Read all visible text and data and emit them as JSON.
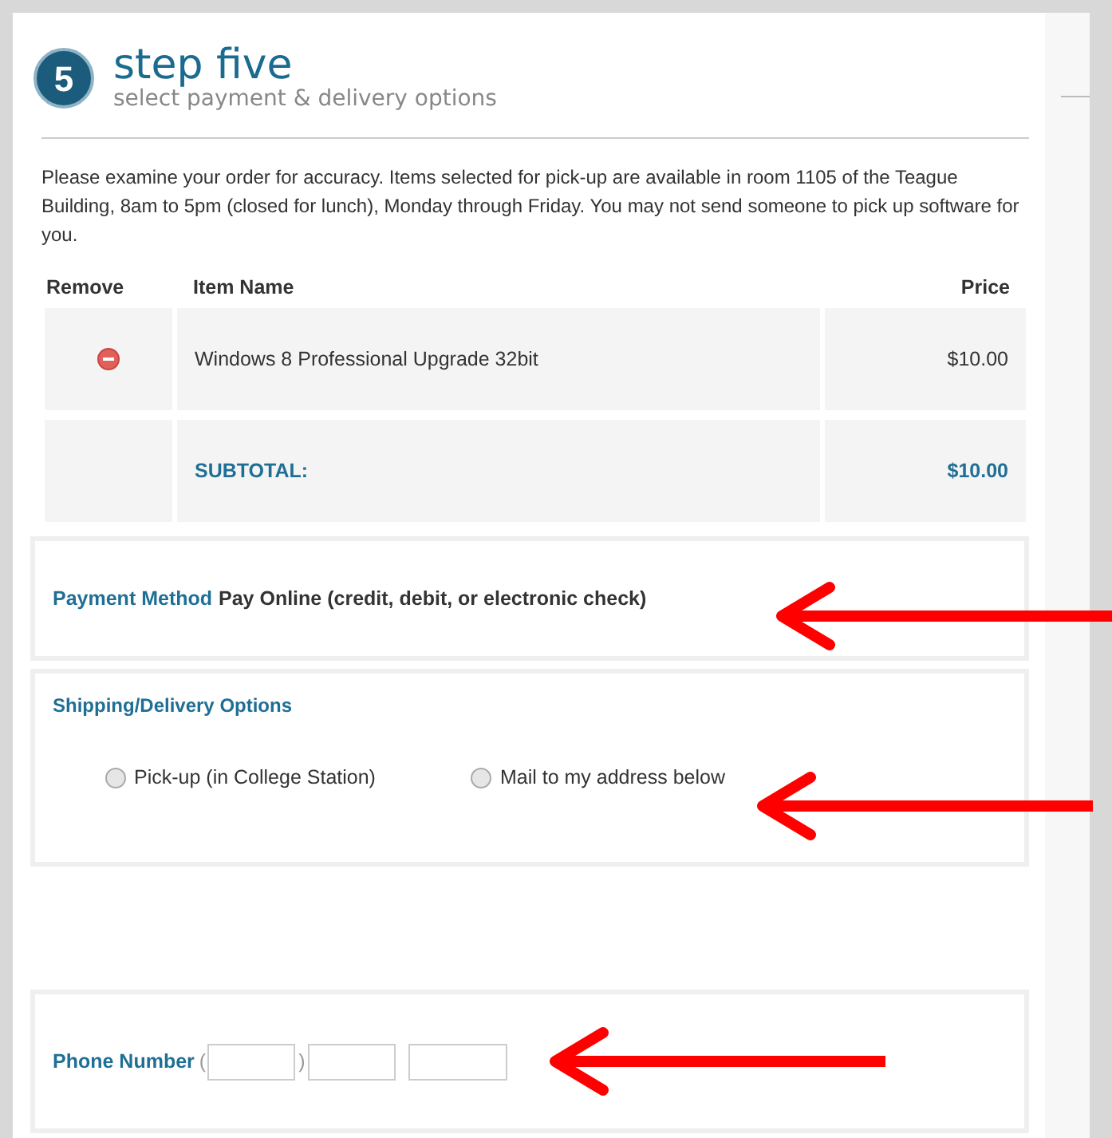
{
  "header": {
    "step_number": "5",
    "title": "step five",
    "subtitle": "select payment & delivery options"
  },
  "intro": "Please examine your order for accuracy. Items selected for pick-up are available in room 1105 of the Teague Building, 8am to 5pm (closed for lunch), Monday through Friday. You may not send someone to pick up software for you.",
  "table": {
    "columns": [
      "Remove",
      "Item Name",
      "Price"
    ],
    "rows": [
      {
        "kind": "item",
        "name": "Windows 8 Professional Upgrade 32bit",
        "price": "$10.00"
      },
      {
        "kind": "subtotal",
        "name": "SUBTOTAL:",
        "price": "$10.00"
      }
    ]
  },
  "payment": {
    "label": "Payment Method",
    "value": "Pay Online (credit, debit, or electronic check)"
  },
  "shipping": {
    "title": "Shipping/Delivery Options",
    "options": [
      {
        "label": "Pick-up (in College Station)",
        "selected": false
      },
      {
        "label": "Mail to my address below",
        "selected": false
      }
    ]
  },
  "phone": {
    "label": "Phone Number",
    "open_paren": "(",
    "close_paren": ")"
  }
}
